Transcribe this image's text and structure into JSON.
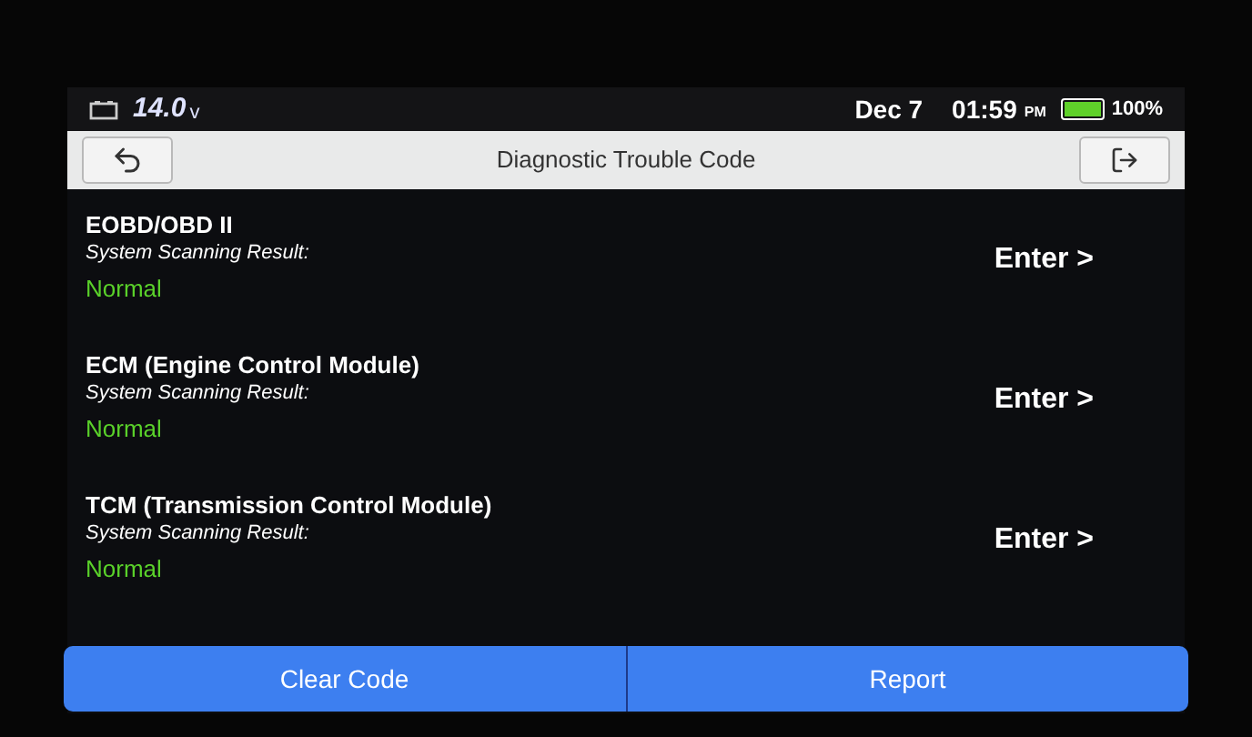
{
  "status_bar": {
    "voltage": "14.0",
    "voltage_unit": "v",
    "date": "Dec 7",
    "time": "01:59",
    "meridiem": "PM",
    "battery": {
      "label": "100%",
      "level": 1
    }
  },
  "header": {
    "title": "Diagnostic Trouble Code"
  },
  "systems": [
    {
      "name": "EOBD/OBD II",
      "label": "System Scanning Result:",
      "result": "Normal",
      "action": "Enter >"
    },
    {
      "name": "ECM (Engine Control Module)",
      "label": "System Scanning Result:",
      "result": "Normal",
      "action": "Enter >"
    },
    {
      "name": "TCM (Transmission Control Module)",
      "label": "System Scanning Result:",
      "result": "Normal",
      "action": "Enter >"
    }
  ],
  "buttons": [
    "Clear Code",
    "Report"
  ]
}
